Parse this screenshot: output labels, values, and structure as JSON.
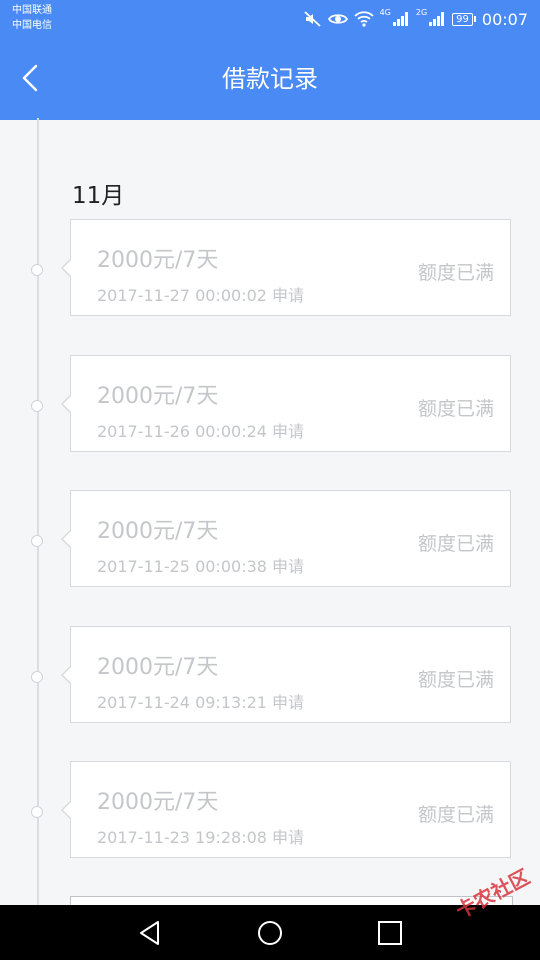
{
  "status_bar": {
    "carrier1": "中国联通",
    "carrier2": "中国电信",
    "network1": "4G",
    "network2": "2G",
    "battery": "99",
    "time": "00:07",
    "icons": [
      "mute-icon",
      "eye-icon",
      "wifi-icon",
      "signal-icon",
      "signal-icon",
      "battery-icon"
    ]
  },
  "header": {
    "title": "借款记录",
    "back_icon": "chevron-left-icon"
  },
  "month_label": "11月",
  "records": [
    {
      "amount": "2000元/7天",
      "date": "2017-11-27 00:00:02 申请",
      "status": "额度已满"
    },
    {
      "amount": "2000元/7天",
      "date": "2017-11-26 00:00:24 申请",
      "status": "额度已满"
    },
    {
      "amount": "2000元/7天",
      "date": "2017-11-25 00:00:38 申请",
      "status": "额度已满"
    },
    {
      "amount": "2000元/7天",
      "date": "2017-11-24 09:13:21 申请",
      "status": "额度已满"
    },
    {
      "amount": "2000元/7天",
      "date": "2017-11-23 19:28:08 申请",
      "status": "额度已满"
    }
  ],
  "watermark": "卡农社区",
  "colors": {
    "header_bg": "#4a8af4",
    "muted_text": "#c4c6ca",
    "timeline": "#d9dde5"
  }
}
